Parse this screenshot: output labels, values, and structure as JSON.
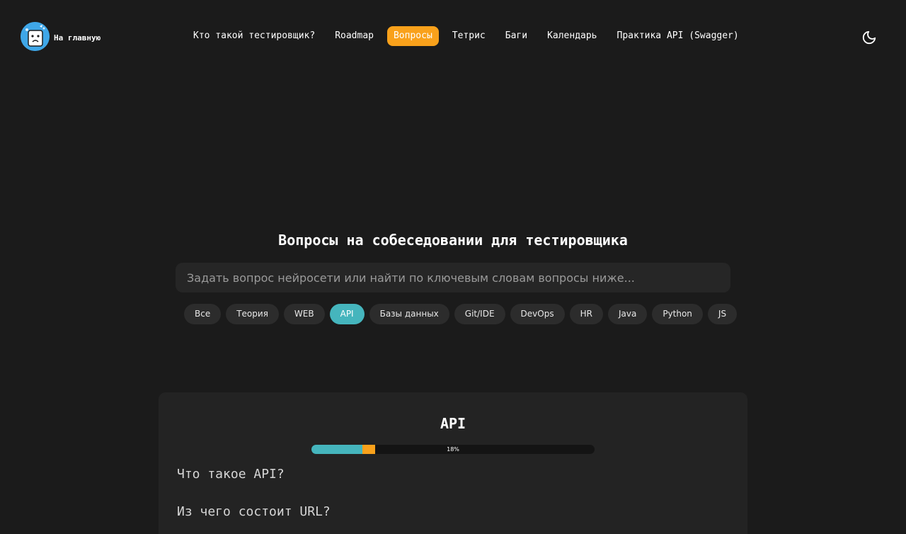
{
  "header": {
    "home_label": "На главную",
    "nav": [
      {
        "label": "Кто такой тестировщик?",
        "active": false
      },
      {
        "label": "Roadmap",
        "active": false
      },
      {
        "label": "Вопросы",
        "active": true
      },
      {
        "label": "Тетрис",
        "active": false
      },
      {
        "label": "Баги",
        "active": false
      },
      {
        "label": "Календарь",
        "active": false
      },
      {
        "label": "Практика API (Swagger)",
        "active": false
      }
    ],
    "theme_icon": "moon-icon"
  },
  "main": {
    "title": "Вопросы на собеседовании для тестировщика",
    "search": {
      "value": "",
      "placeholder": "Задать вопрос нейросети или найти по ключевым словам вопросы ниже..."
    },
    "filters": [
      {
        "label": "Все",
        "active": false
      },
      {
        "label": "Теория",
        "active": false
      },
      {
        "label": "WEB",
        "active": false
      },
      {
        "label": "API",
        "active": true
      },
      {
        "label": "Базы данных",
        "active": false
      },
      {
        "label": "Git/IDE",
        "active": false
      },
      {
        "label": "DevOps",
        "active": false
      },
      {
        "label": "HR",
        "active": false
      },
      {
        "label": "Java",
        "active": false
      },
      {
        "label": "Python",
        "active": false
      },
      {
        "label": "JS",
        "active": false
      }
    ]
  },
  "section": {
    "title": "API",
    "progress": {
      "label": "18%",
      "done_fraction": 0.18,
      "current_fraction": 0.045
    },
    "questions": [
      "Что такое API?",
      "Из чего состоит URL?"
    ]
  },
  "colors": {
    "accent_orange": "#f9a11b",
    "accent_teal": "#45b5bd",
    "background": "#1b1b1b",
    "card": "#232323"
  }
}
